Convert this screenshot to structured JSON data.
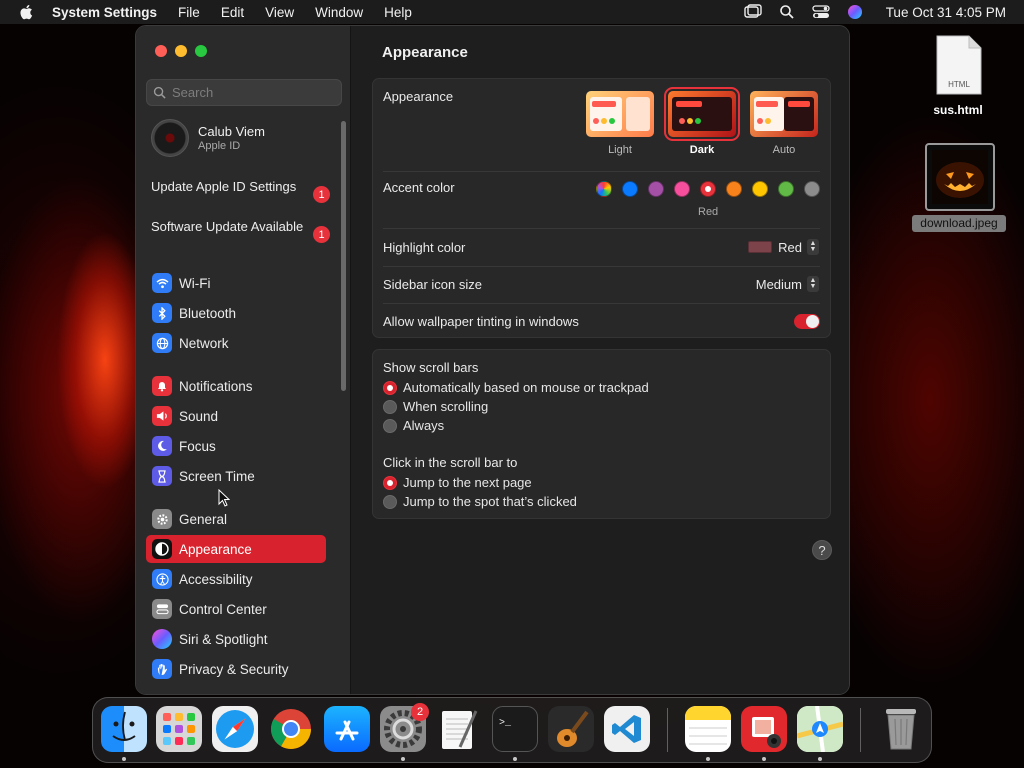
{
  "menubar": {
    "app_name": "System Settings",
    "menus": [
      "File",
      "Edit",
      "View",
      "Window",
      "Help"
    ],
    "clock": "Tue Oct 31  4:05 PM"
  },
  "sidebar": {
    "search_placeholder": "Search",
    "profile": {
      "name": "Calub Viem",
      "subtitle": "Apple ID"
    },
    "notices": [
      {
        "label": "Update Apple ID Settings",
        "badge": "1"
      },
      {
        "label": "Software Update Available",
        "badge": "1"
      }
    ],
    "items": [
      {
        "label": "Wi-Fi",
        "icon": "wifi-icon",
        "color": "#2f7cf6"
      },
      {
        "label": "Bluetooth",
        "icon": "bluetooth-icon",
        "color": "#2f7cf6"
      },
      {
        "label": "Network",
        "icon": "network-icon",
        "color": "#2f7cf6"
      },
      {
        "label": "Notifications",
        "icon": "notifications-icon",
        "color": "#e8323b"
      },
      {
        "label": "Sound",
        "icon": "sound-icon",
        "color": "#e8323b"
      },
      {
        "label": "Focus",
        "icon": "focus-icon",
        "color": "#5e5ce6"
      },
      {
        "label": "Screen Time",
        "icon": "screen-time-icon",
        "color": "#5e5ce6"
      },
      {
        "label": "General",
        "icon": "gear-icon",
        "color": "#8a8a8a"
      },
      {
        "label": "Appearance",
        "icon": "appearance-icon",
        "color": "#1a1a1a"
      },
      {
        "label": "Accessibility",
        "icon": "accessibility-icon",
        "color": "#2f7cf6"
      },
      {
        "label": "Control Center",
        "icon": "control-center-icon",
        "color": "#8a8a8a"
      },
      {
        "label": "Siri & Spotlight",
        "icon": "siri-icon",
        "color": "#b03ad0"
      },
      {
        "label": "Privacy & Security",
        "icon": "hand-icon",
        "color": "#2f7cf6"
      }
    ],
    "active": "Appearance"
  },
  "main": {
    "title": "Appearance",
    "appearance": {
      "label": "Appearance",
      "options": [
        "Light",
        "Dark",
        "Auto"
      ],
      "selected": "Dark"
    },
    "accent": {
      "label": "Accent color",
      "colors": [
        "multicolor",
        "#0a7aff",
        "#a550a7",
        "#f74f9e",
        "#e8323b",
        "#f7821b",
        "#ffc600",
        "#62ba46",
        "#8c8c8c"
      ],
      "selected_name": "Red"
    },
    "highlight": {
      "label": "Highlight color",
      "value": "Red"
    },
    "sidebar_icon_size": {
      "label": "Sidebar icon size",
      "value": "Medium"
    },
    "wallpaper_tinting": {
      "label": "Allow wallpaper tinting in windows",
      "on": true
    },
    "scroll_bars": {
      "label": "Show scroll bars",
      "options": [
        "Automatically based on mouse or trackpad",
        "When scrolling",
        "Always"
      ],
      "selected": 0
    },
    "click_scroll": {
      "label": "Click in the scroll bar to",
      "options": [
        "Jump to the next page",
        "Jump to the spot that’s clicked"
      ],
      "selected": 0
    },
    "help": "?"
  },
  "desktop": {
    "file1": {
      "name": "sus.html",
      "type_label": "HTML"
    },
    "file2": {
      "name": "download.jpeg"
    }
  },
  "dock": {
    "apps": [
      "Finder",
      "Launchpad",
      "Safari",
      "Chrome",
      "App Store",
      "System Settings",
      "TextEdit",
      "Terminal",
      "GarageBand",
      "Visual Studio Code",
      "Notes",
      "Photo Booth",
      "Maps",
      "Trash"
    ],
    "settings_badge": "2"
  }
}
